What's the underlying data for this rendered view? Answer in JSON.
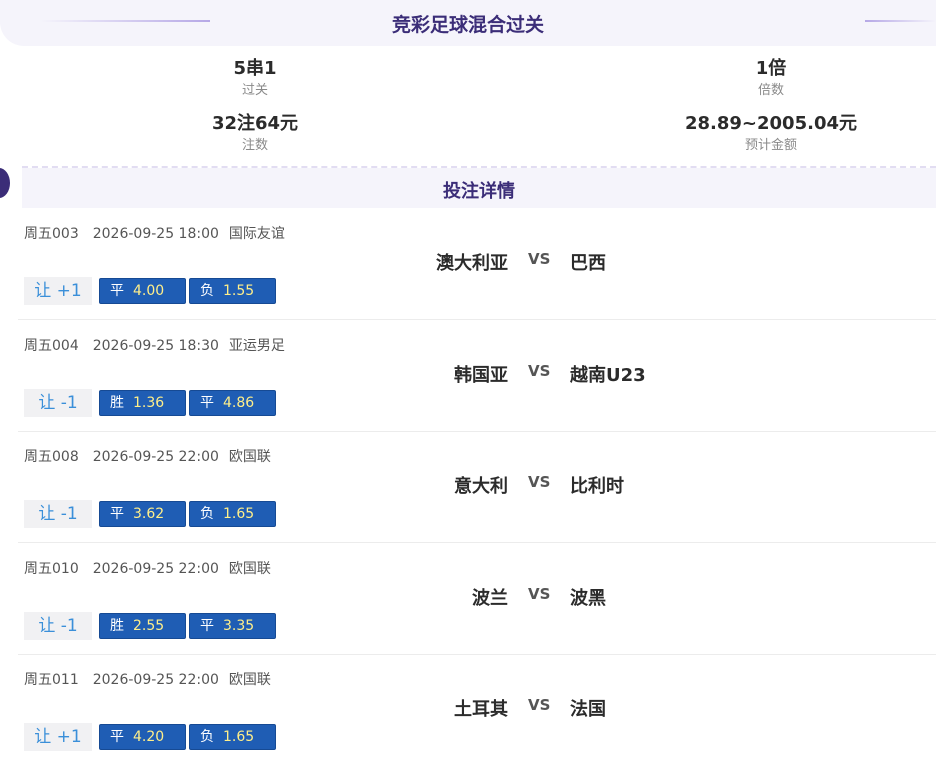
{
  "header": {
    "title": "竞彩足球混合过关"
  },
  "summary": {
    "pass_type": {
      "value": "5串1",
      "label": "过关"
    },
    "multiplier": {
      "value": "1倍",
      "label": "倍数"
    },
    "bets": {
      "value": "32注64元",
      "label": "注数"
    },
    "prize": {
      "value": "28.89~2005.04元",
      "label": "预计金额"
    }
  },
  "details": {
    "title": "投注详情"
  },
  "vs_label": "VS",
  "matches": [
    {
      "code": "周五003",
      "datetime": "2026-09-25 18:00",
      "league": "国际友谊",
      "home": "澳大利亚",
      "away": "巴西",
      "handicap": "让 +1",
      "odds": [
        {
          "label": "平",
          "value": "4.00"
        },
        {
          "label": "负",
          "value": "1.55"
        }
      ]
    },
    {
      "code": "周五004",
      "datetime": "2026-09-25 18:30",
      "league": "亚运男足",
      "home": "韩国亚",
      "away": "越南U23",
      "handicap": "让 -1",
      "odds": [
        {
          "label": "胜",
          "value": "1.36"
        },
        {
          "label": "平",
          "value": "4.86"
        }
      ]
    },
    {
      "code": "周五008",
      "datetime": "2026-09-25 22:00",
      "league": "欧国联",
      "home": "意大利",
      "away": "比利时",
      "handicap": "让 -1",
      "odds": [
        {
          "label": "平",
          "value": "3.62"
        },
        {
          "label": "负",
          "value": "1.65"
        }
      ]
    },
    {
      "code": "周五010",
      "datetime": "2026-09-25 22:00",
      "league": "欧国联",
      "home": "波兰",
      "away": "波黑",
      "handicap": "让 -1",
      "odds": [
        {
          "label": "胜",
          "value": "2.55"
        },
        {
          "label": "平",
          "value": "3.35"
        }
      ]
    },
    {
      "code": "周五011",
      "datetime": "2026-09-25 22:00",
      "league": "欧国联",
      "home": "土耳其",
      "away": "法国",
      "handicap": "让 +1",
      "odds": [
        {
          "label": "平",
          "value": "4.20"
        },
        {
          "label": "负",
          "value": "1.65"
        }
      ]
    }
  ]
}
